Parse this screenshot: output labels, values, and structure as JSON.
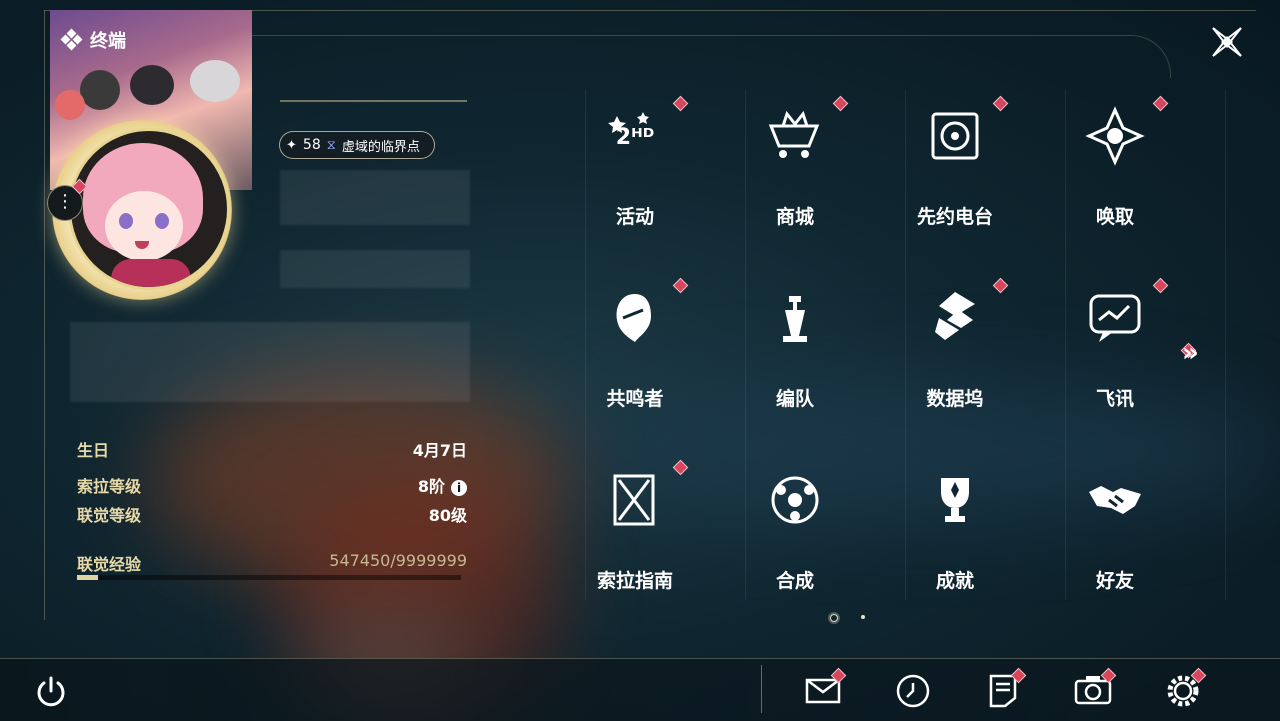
{
  "header": {
    "terminal_label": "终端"
  },
  "profile": {
    "level": "58",
    "title": "虚域的临界点",
    "info": [
      {
        "key": "生日",
        "value": "4月7日"
      },
      {
        "key": "索拉等级",
        "value": "8阶"
      },
      {
        "key": "联觉等级",
        "value": "80级"
      }
    ],
    "exp": {
      "label": "联觉经验",
      "value": "547450/9999999",
      "fraction": 0.055
    }
  },
  "menu": [
    {
      "label": "活动",
      "icon": "activity-icon",
      "badge": true
    },
    {
      "label": "商城",
      "icon": "shop-cart-icon",
      "badge": true
    },
    {
      "label": "先约电台",
      "icon": "radio-icon",
      "badge": true
    },
    {
      "label": "唤取",
      "icon": "summon-icon",
      "badge": true
    },
    {
      "label": "共鸣者",
      "icon": "resonator-icon",
      "badge": true
    },
    {
      "label": "编队",
      "icon": "chess-team-icon",
      "badge": false
    },
    {
      "label": "数据坞",
      "icon": "databank-icon",
      "badge": true
    },
    {
      "label": "飞讯",
      "icon": "message-icon",
      "badge": true
    },
    {
      "label": "索拉指南",
      "icon": "guide-icon",
      "badge": true
    },
    {
      "label": "合成",
      "icon": "synthesis-icon",
      "badge": false
    },
    {
      "label": "成就",
      "icon": "trophy-icon",
      "badge": false
    },
    {
      "label": "好友",
      "icon": "handshake-icon",
      "badge": false
    }
  ],
  "bottom_icons": [
    "mail-icon",
    "clock-icon",
    "notes-icon",
    "camera-icon",
    "settings-icon"
  ],
  "colors": {
    "badge": "#d9455a",
    "accent": "#e2d4a2"
  }
}
